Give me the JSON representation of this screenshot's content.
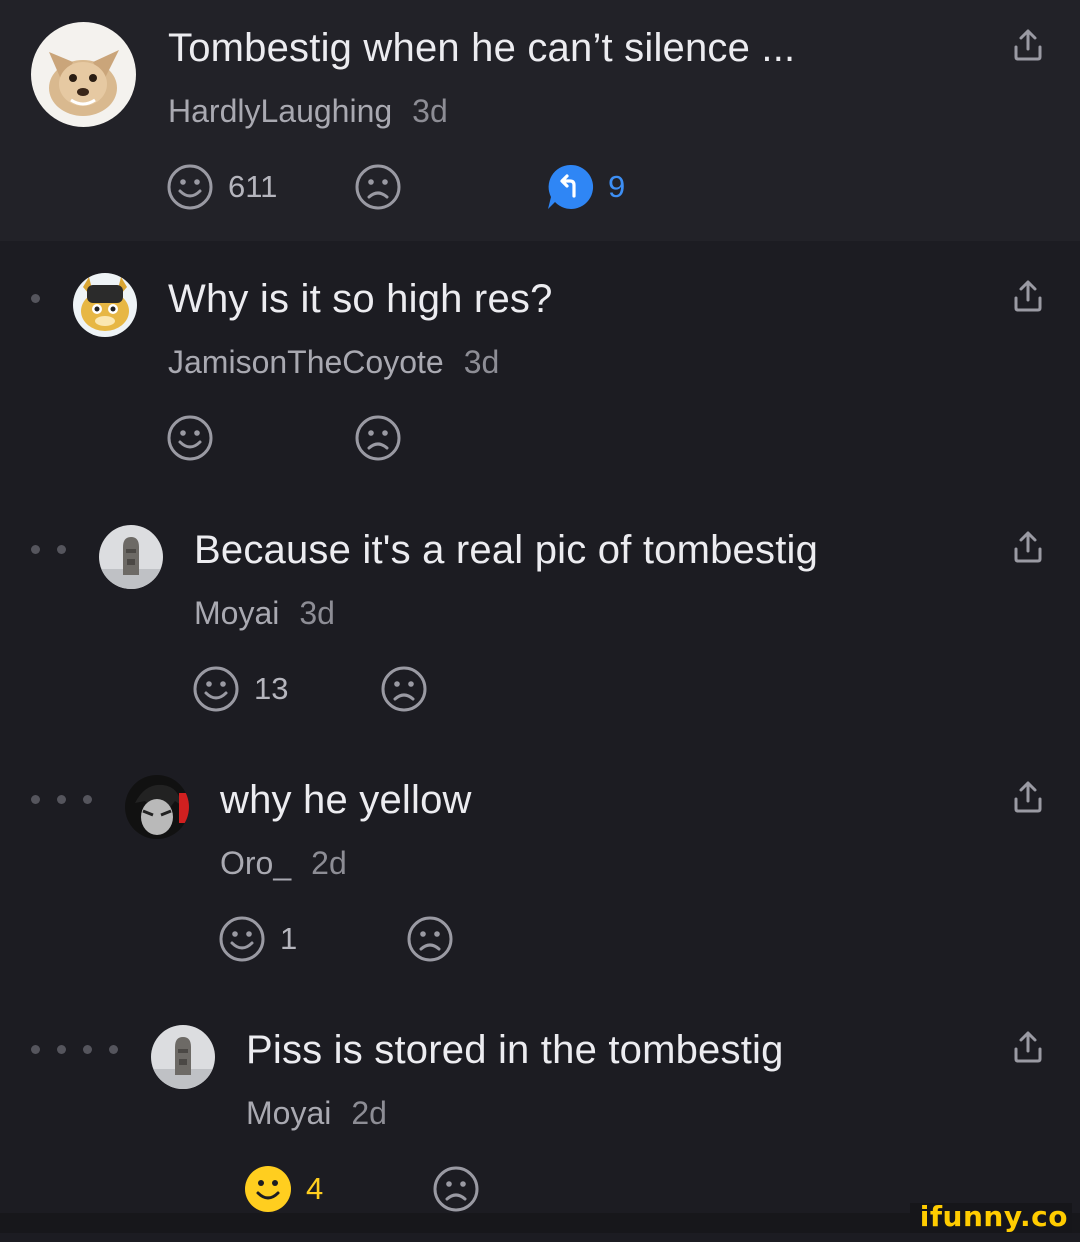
{
  "comments": [
    {
      "text": "Tombestig when he can’t silence ...",
      "author": "HardlyLaughing",
      "time": "3d",
      "smiles": "611",
      "frowns": "",
      "replies": "9",
      "avatar": "chihuahua-avatar"
    },
    {
      "text": "Why is it so high res?",
      "author": "JamisonTheCoyote",
      "time": "3d",
      "smiles": "",
      "frowns": "",
      "avatar": "cartoon-coyote-avatar"
    },
    {
      "text": "Because it's a real pic of tombestig",
      "author": "Moyai",
      "time": "3d",
      "smiles": "13",
      "frowns": "",
      "avatar": "moai-statue-avatar"
    },
    {
      "text": "why he yellow",
      "author": "Oro_",
      "time": "2d",
      "smiles": "1",
      "frowns": "",
      "avatar": "anime-character-avatar"
    },
    {
      "text": "Piss is stored in the tombestig",
      "author": "Moyai",
      "time": "2d",
      "smiles": "4",
      "frowns": "",
      "avatar": "moai-statue-avatar",
      "smiled": true
    }
  ],
  "icons": {
    "share": "share-icon",
    "smile": "smile-icon",
    "frown": "frown-icon",
    "reply": "reply-bubble-icon"
  },
  "colors": {
    "background": "#1c1c22",
    "op_background": "#222228",
    "reply_blue": "#3d8ff5",
    "smile_yellow": "#ffce1f"
  },
  "watermark": "ifunny.co"
}
